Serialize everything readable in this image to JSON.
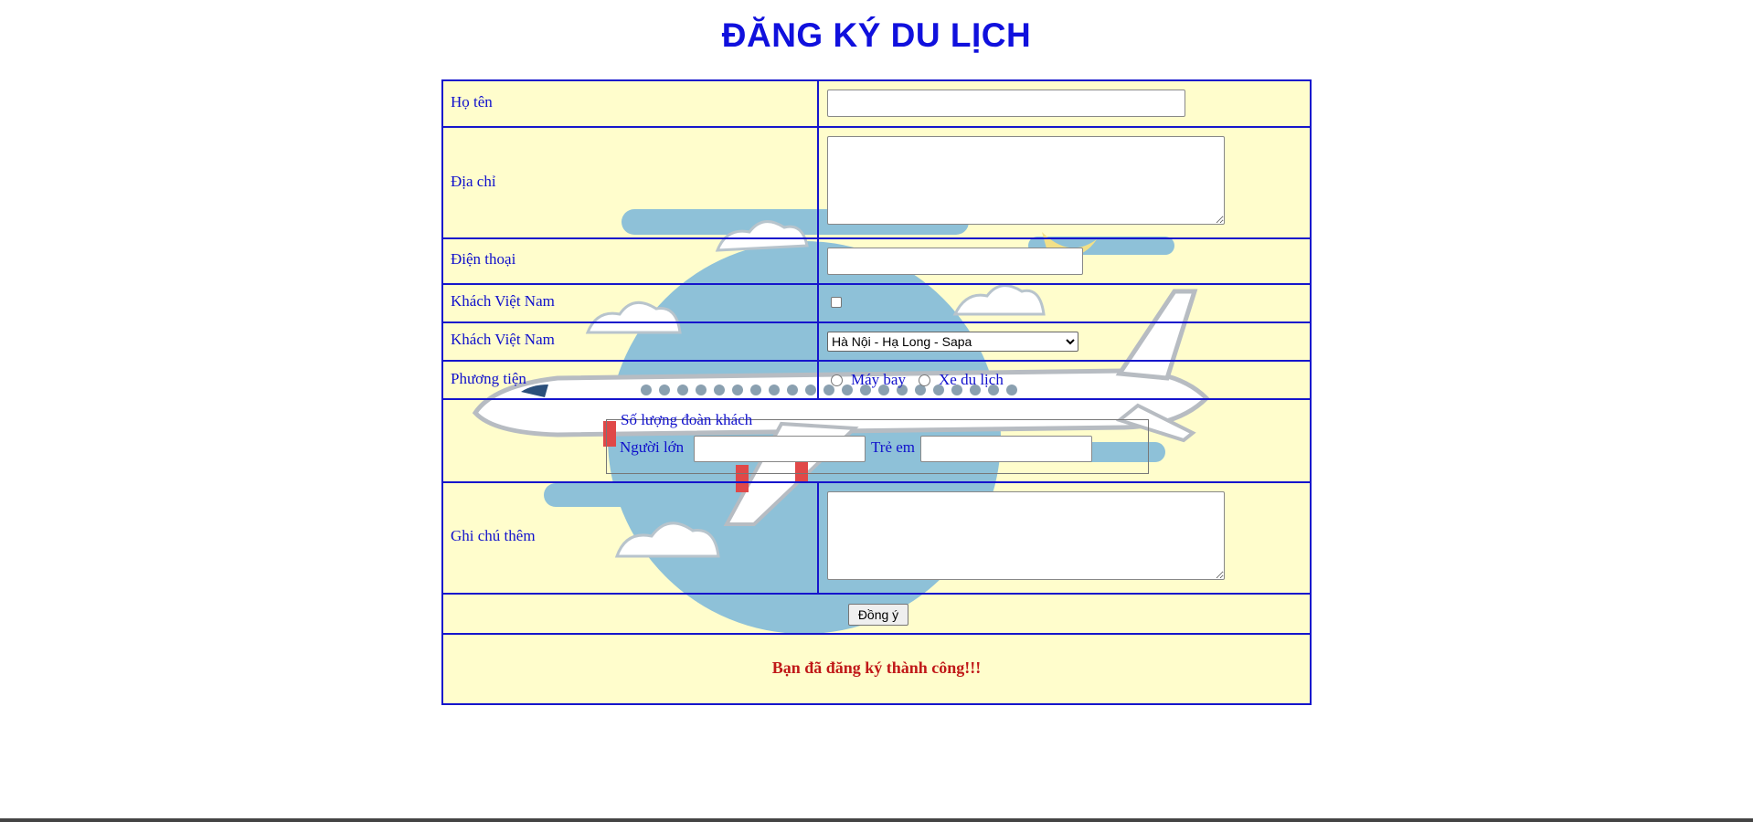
{
  "page": {
    "title": "ĐĂNG KÝ DU LỊCH"
  },
  "form": {
    "full_name": {
      "label": "Họ tên",
      "value": ""
    },
    "address": {
      "label": "Địa chỉ",
      "value": ""
    },
    "phone": {
      "label": "Điện thoại",
      "value": ""
    },
    "vietnamese_guest": {
      "label": "Khách Việt Nam",
      "checked": false
    },
    "tour": {
      "label": "Khách Việt Nam",
      "selected": "Hà Nội - Hạ Long - Sapa"
    },
    "transport": {
      "label": "Phương tiện",
      "options": [
        "Máy bay",
        "Xe du lịch"
      ],
      "selected": null
    },
    "group_size": {
      "legend": "Số lượng đoàn khách",
      "adults_label": "Người lớn",
      "adults_value": "",
      "children_label": "Trẻ em",
      "children_value": ""
    },
    "notes": {
      "label": "Ghi chú thêm",
      "value": ""
    },
    "submit_label": "Đồng ý",
    "success_message": "Bạn đã đăng ký thành công!!!"
  },
  "colors": {
    "title": "#1010dd",
    "border": "#1515cc",
    "form_bg": "#fffdcc",
    "success": "#c01818"
  }
}
